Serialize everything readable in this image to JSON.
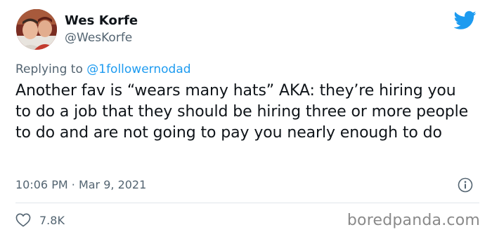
{
  "author": {
    "name": "Wes Korfe",
    "handle": "@WesKorfe"
  },
  "reply": {
    "prefix": "Replying to ",
    "mention": "@1followernodad"
  },
  "tweet": {
    "text": "Another fav is “wears many hats” AKA: they’re hiring you to do a job that they should be hiring three or more people to do and are not going to pay you nearly enough to do",
    "time": "10:06 PM",
    "separator": "·",
    "date": "Mar 9, 2021",
    "likes": "7.8K"
  },
  "watermark": "boredpanda.com",
  "icons": {
    "logo": "twitter-bird-icon",
    "info": "info-icon",
    "like": "heart-icon"
  },
  "colors": {
    "twitter_blue": "#1d9bf0",
    "secondary_text": "#536471",
    "primary_text": "#0f1419"
  }
}
